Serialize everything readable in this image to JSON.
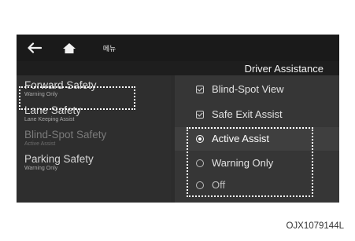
{
  "topbar": {
    "back_icon": "arrow-left-icon",
    "home_icon": "home-icon",
    "menu_label": "메뉴"
  },
  "section_title": "Driver Assistance",
  "categories": [
    {
      "title": "Forward Safety",
      "subtitle": "Warning Only"
    },
    {
      "title": "Lane Safety",
      "subtitle": "Lane Keeping Assist"
    },
    {
      "title": "Blind-Spot Safety",
      "subtitle": "Active Assist",
      "selected": true
    },
    {
      "title": "Parking Safety",
      "subtitle": "Warning Only"
    }
  ],
  "options": [
    {
      "label": "Blind-Spot View",
      "control": "checkbox",
      "checked": true
    },
    {
      "label": "Safe Exit Assist",
      "control": "checkbox",
      "checked": true
    },
    {
      "label": "Active Assist",
      "control": "radio",
      "checked": true
    },
    {
      "label": "Warning Only",
      "control": "radio",
      "checked": false
    },
    {
      "label": "Off",
      "control": "radio",
      "checked": false
    }
  ],
  "figure_code": "OJX1079144L",
  "colors": {
    "screen_bg": "#2c2c2c",
    "topbar_bg": "#1a1a1a",
    "highlight_border": "#ffffff"
  }
}
